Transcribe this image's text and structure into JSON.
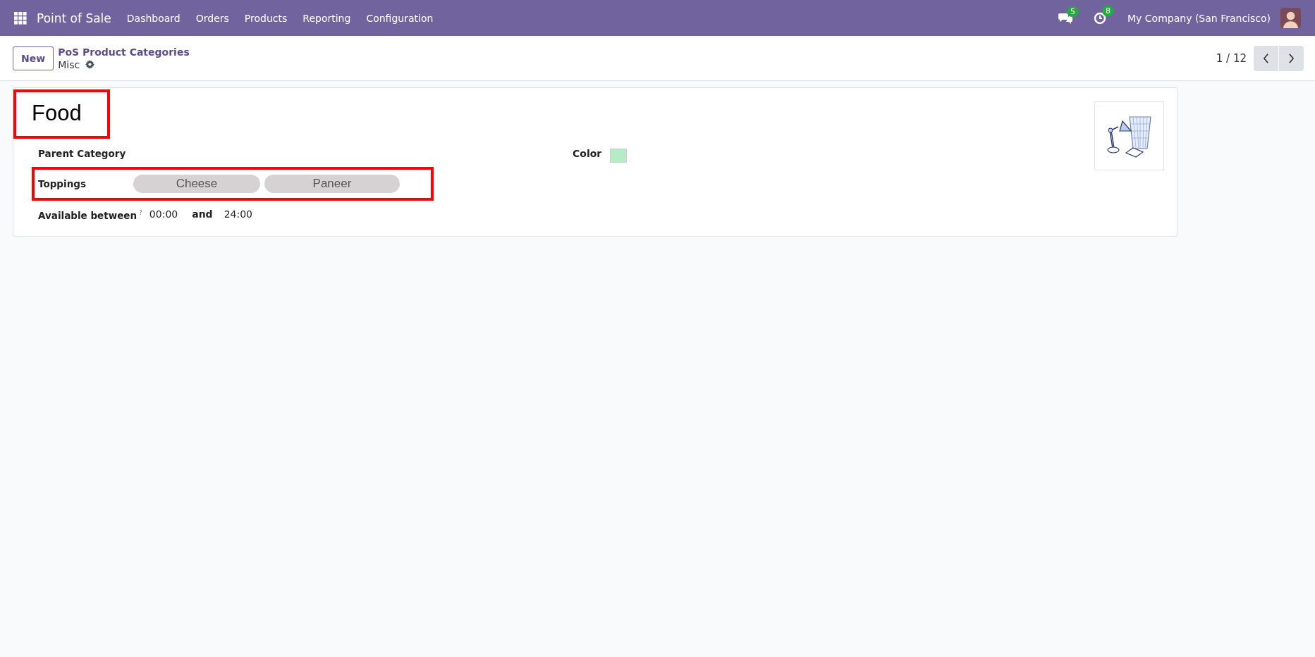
{
  "navbar": {
    "app_name": "Point of Sale",
    "menu": [
      "Dashboard",
      "Orders",
      "Products",
      "Reporting",
      "Configuration"
    ],
    "messages_count": "5",
    "activities_count": "8",
    "company": "My Company (San Francisco)"
  },
  "control_panel": {
    "new_button": "New",
    "breadcrumb": "PoS Product Categories",
    "record": "Misc",
    "pager": "1 / 12"
  },
  "form": {
    "name": "Food",
    "name_highlighted": true,
    "fields": [
      {
        "kind": "text",
        "label": "Parent Category",
        "highlighted": false
      },
      {
        "kind": "tags",
        "label": "Toppings",
        "highlighted": true,
        "tags": [
          "Cheese",
          "Paneer"
        ]
      },
      {
        "kind": "time_range",
        "label": "Available between",
        "help": "?",
        "from": "00:00",
        "joiner": "and",
        "to": "24:00",
        "highlighted": false
      }
    ],
    "color_field": {
      "label": "Color",
      "color": "#b5ecc5"
    }
  }
}
